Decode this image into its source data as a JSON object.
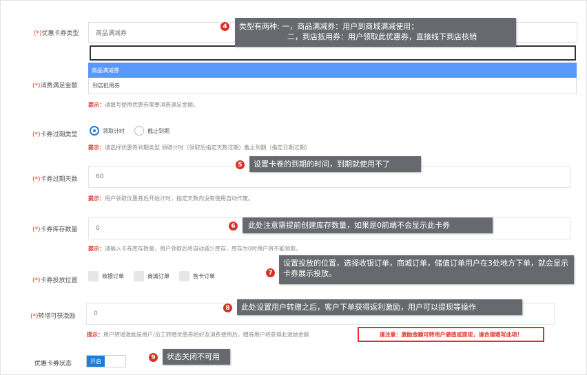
{
  "form": {
    "coupon_type": {
      "req": "(*)",
      "label": "优惠卡券类型",
      "value": "商品满减券",
      "options": [
        "商品满减券",
        "到店抵用券"
      ]
    },
    "min_amount": {
      "req": "(*)",
      "label": "消费满足金额",
      "hint_prefix": "提示：",
      "hint": "请填写使用优惠券需要消费满足金额。"
    },
    "expiry_type": {
      "req": "(*)",
      "label": "卡券过期类型",
      "options": [
        "领取计时",
        "截止到期"
      ],
      "selected": "领取计时",
      "hint_prefix": "提示：",
      "hint": "请选择优惠券到期类型 领取计时（领取后指定天数过期）截止到期（指定日期过期）"
    },
    "expiry_days": {
      "req": "(*)",
      "label": "卡券过期天数",
      "value": "60",
      "hint_prefix": "提示：",
      "hint": "用户领取优惠券后开始计时，指定天数内没有使用自动作废。"
    },
    "stock": {
      "req": "(*)",
      "label": "卡券库存数量",
      "value": "0",
      "hint_prefix": "提示：",
      "hint": "请输入卡券库存数量，用户领取后将自动减少库存，库存为0时用户将不能领取。"
    },
    "placement": {
      "req": "(*)",
      "label": "卡券投放位置",
      "options": [
        "收银订单",
        "商城订单",
        "售卡订单"
      ]
    },
    "transfer_reward": {
      "req": "(*)",
      "label": "转增可获激励",
      "value": "0",
      "hint_prefix": "提示：",
      "hint": "用户转增激励是用户/员工转赠优惠券给好友消费使用后，赠券用户将获得此激励金额",
      "warning": "请注意：激励金额可转用户储值或提现，请合理填写此项！"
    },
    "status": {
      "label": "优惠卡券状态",
      "toggle_label": "开启"
    }
  },
  "annotations": [
    {
      "num": "4",
      "lines": [
        "类型有两种: 一，商品满减券：用户到商城满减使用；",
        "二，到店抵用券：用户领取此优惠券，直接线下到店核销"
      ]
    },
    {
      "num": "5",
      "lines": [
        "设置卡卷的到期的时间，到期就使用不了"
      ]
    },
    {
      "num": "6",
      "lines": [
        "此处注意需提前创建库存数量，如果是0前端不会显示此卡券"
      ]
    },
    {
      "num": "7",
      "lines": [
        "设置投放的位置，选择收银订单，商城订单，储值订单用户在3处地方下单，就会显示卡券展示投放。"
      ]
    },
    {
      "num": "8",
      "lines": [
        "此处设置用户转赠之后，客户下单获得返利激励，用户可以提现等操作"
      ]
    },
    {
      "num": "9",
      "lines": [
        "状态关闭不可用"
      ]
    }
  ],
  "colors": {
    "required": "#e0301e",
    "accent": "#1e7bd8",
    "dropdown_selected": "#5897fb",
    "tooltip": "#666a6f",
    "badge": "#d93025",
    "warning": "#e0302a"
  }
}
